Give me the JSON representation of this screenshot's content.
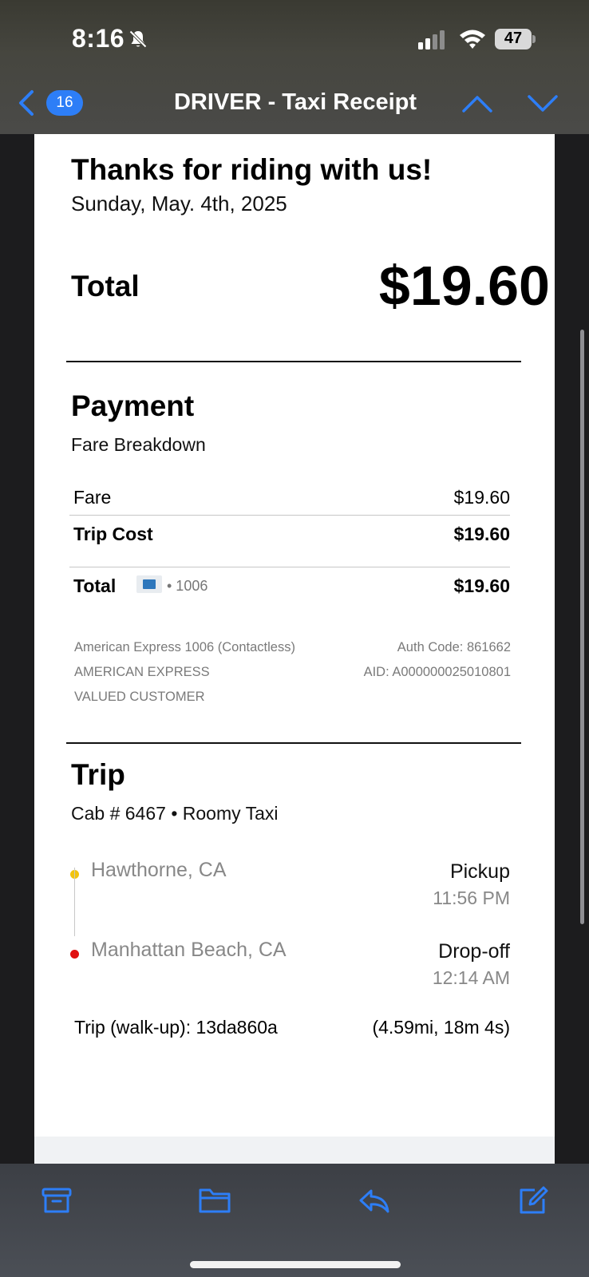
{
  "status_bar": {
    "time": "8:16",
    "battery": "47",
    "icons": [
      "bell-slash-icon",
      "signal-bars-icon",
      "wifi-icon",
      "battery-icon"
    ]
  },
  "nav": {
    "badge_count": "16",
    "title": "DRIVER - Taxi Receipt",
    "icons": [
      "chevron-left-icon",
      "chevron-up-icon",
      "chevron-down-icon"
    ],
    "accent": "#2d7ef7"
  },
  "receipt": {
    "heading": "Thanks for riding with us!",
    "date": "Sunday, May. 4th, 2025",
    "total_label": "Total",
    "total_value": "$19.60",
    "payment": {
      "heading": "Payment",
      "subheading": "Fare Breakdown",
      "fare_label": "Fare",
      "fare_value": "$19.60",
      "trip_cost_label": "Trip Cost",
      "trip_cost_value": "$19.60",
      "total_label": "Total",
      "card_last": "• 1006",
      "total_value": "$19.60",
      "card_line": "American Express 1006 (Contactless)",
      "card_brand": "AMERICAN EXPRESS",
      "cardholder": "VALUED CUSTOMER",
      "auth_code": "Auth Code: 861662",
      "aid": "AID: A000000025010801"
    },
    "trip": {
      "heading": "Trip",
      "cab_line": "Cab # 6467 • Roomy Taxi",
      "pickup_location": "Hawthorne, CA",
      "pickup_label": "Pickup",
      "pickup_time": "11:56 PM",
      "dropoff_location": "Manhattan Beach, CA",
      "dropoff_label": "Drop-off",
      "dropoff_time": "12:14 AM",
      "trip_id": "Trip (walk-up): 13da860a",
      "trip_stats": "(4.59mi, 18m 4s)",
      "pickup_color": "#f2c40f",
      "dropoff_color": "#e01010"
    }
  },
  "toolbar": {
    "icons": [
      "archive-icon",
      "folder-icon",
      "reply-icon",
      "compose-icon"
    ]
  }
}
